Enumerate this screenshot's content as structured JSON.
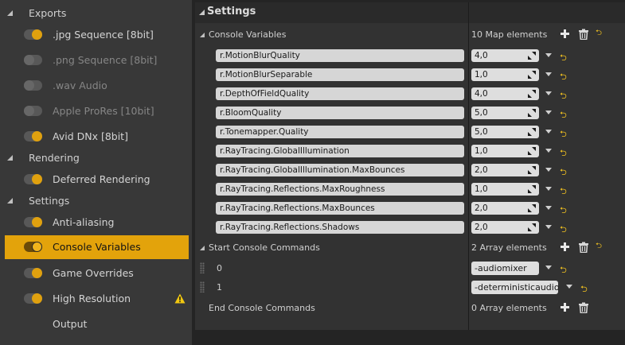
{
  "sidebar": {
    "sections": [
      {
        "label": "Exports"
      },
      {
        "label": "Rendering"
      },
      {
        "label": "Settings"
      }
    ],
    "exports_items": [
      {
        "label": ".jpg Sequence [8bit]",
        "enabled": true
      },
      {
        "label": ".png Sequence [8bit]",
        "enabled": false
      },
      {
        "label": ".wav Audio",
        "enabled": false
      },
      {
        "label": "Apple ProRes [10bit]",
        "enabled": false
      },
      {
        "label": "Avid DNx [8bit]",
        "enabled": true
      }
    ],
    "rendering_items": [
      {
        "label": "Deferred Rendering",
        "enabled": true
      }
    ],
    "settings_items": [
      {
        "label": "Anti-aliasing",
        "enabled": true
      },
      {
        "label": "Console Variables",
        "enabled": true,
        "selected": true
      },
      {
        "label": "Game Overrides",
        "enabled": true
      },
      {
        "label": "High Resolution",
        "enabled": true,
        "warning": true
      },
      {
        "label": "Output"
      }
    ],
    "accent_color": "#e3a30b"
  },
  "panel": {
    "title": "Settings",
    "console_variables": {
      "label": "Console Variables",
      "count": "10 Map elements",
      "entries": [
        {
          "key": "r.MotionBlurQuality",
          "value": "4,0"
        },
        {
          "key": "r.MotionBlurSeparable",
          "value": "1,0"
        },
        {
          "key": "r.DepthOfFieldQuality",
          "value": "4,0"
        },
        {
          "key": "r.BloomQuality",
          "value": "5,0"
        },
        {
          "key": "r.Tonemapper.Quality",
          "value": "5,0"
        },
        {
          "key": "r.RayTracing.GlobalIllumination",
          "value": "1,0"
        },
        {
          "key": "r.RayTracing.GlobalIllumination.MaxBounces",
          "value": "2,0"
        },
        {
          "key": "r.RayTracing.Reflections.MaxRoughness",
          "value": "1,0"
        },
        {
          "key": "r.RayTracing.Reflections.MaxBounces",
          "value": "2,0"
        },
        {
          "key": "r.RayTracing.Reflections.Shadows",
          "value": "2,0"
        }
      ]
    },
    "start_console_commands": {
      "label": "Start Console Commands",
      "count": "2 Array elements",
      "entries": [
        {
          "index": "0",
          "value": "-audiomixer"
        },
        {
          "index": "1",
          "value": "-deterministicaudio"
        }
      ]
    },
    "end_console_commands": {
      "label": "End Console Commands",
      "count": "0 Array elements"
    }
  },
  "icons": {
    "add": "plus-icon",
    "delete": "trash-icon",
    "reset": "reset-to-default-icon",
    "warning": "warning-icon"
  }
}
